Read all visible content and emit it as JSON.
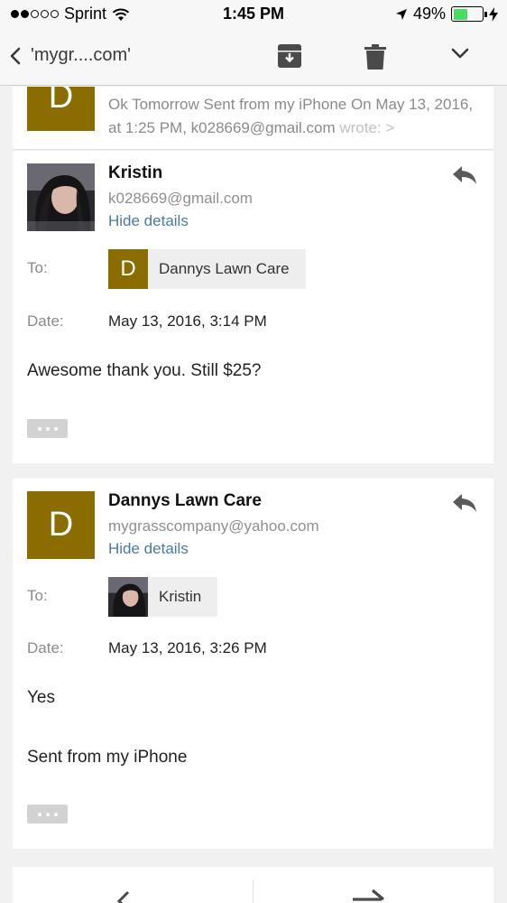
{
  "status_bar": {
    "carrier": "Sprint",
    "time": "1:45 PM",
    "battery": "49%",
    "battery_level": 0.49,
    "signal_bars_filled": 2,
    "signal_bars_total": 5
  },
  "toolbar": {
    "back_label": "'mygr....com'",
    "icons": [
      "chevron-left-icon",
      "archive-icon",
      "trash-icon",
      "chevron-down-icon"
    ]
  },
  "collapsed_message": {
    "avatar_letter": "D",
    "snippet": "Ok Tomorrow Sent from my iPhone On May 13, 2016, at 1:25 PM, k028669@gmail.com",
    "snippet_faded": "wrote: >"
  },
  "messages": [
    {
      "sender": "Kristin",
      "email": "k028669@gmail.com",
      "hide_details": "Hide details",
      "to_label": "To:",
      "to_avatar_letter": "D",
      "to_name": "Dannys Lawn Care",
      "date_label": "Date:",
      "date": "May 13, 2016, 3:14 PM",
      "body": [
        "Awesome thank you. Still $25?"
      ]
    },
    {
      "sender": "Dannys Lawn Care",
      "avatar_letter": "D",
      "email": "mygrasscompany@yahoo.com",
      "hide_details": "Hide details",
      "to_label": "To:",
      "to_name": "Kristin",
      "date_label": "Date:",
      "date": "May 13, 2016, 3:26 PM",
      "body": [
        "Yes",
        "Sent from my iPhone"
      ]
    }
  ],
  "colors": {
    "avatar_bg": "#8a6c00",
    "link": "#4a78a8",
    "battery": "#4cd964"
  }
}
